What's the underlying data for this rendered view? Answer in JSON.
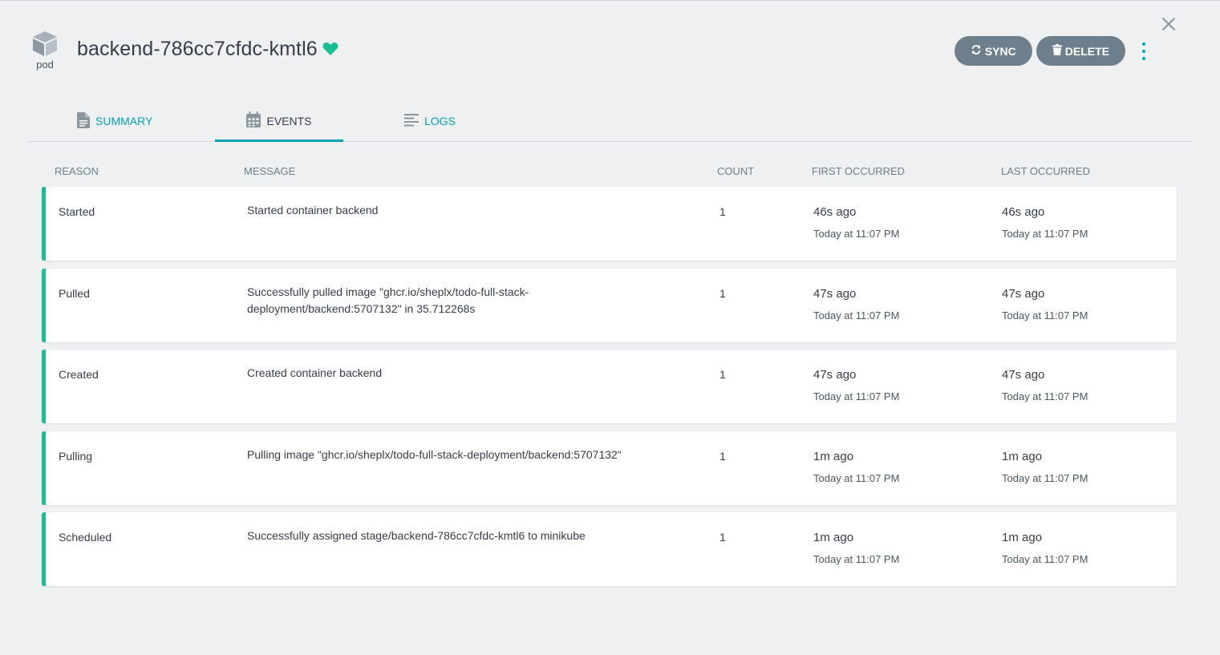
{
  "header": {
    "kind_label": "pod",
    "title": "backend-786cc7cfdc-kmtl6",
    "sync_label": "SYNC",
    "delete_label": "DELETE"
  },
  "tabs": [
    {
      "label": "SUMMARY"
    },
    {
      "label": "EVENTS"
    },
    {
      "label": "LOGS"
    }
  ],
  "columns": {
    "reason": "REASON",
    "message": "MESSAGE",
    "count": "COUNT",
    "first": "FIRST OCCURRED",
    "last": "LAST OCCURRED"
  },
  "events": [
    {
      "reason": "Started",
      "message": "Started container backend",
      "count": "1",
      "first_ago": "46s ago",
      "first_abs": "Today at 11:07 PM",
      "last_ago": "46s ago",
      "last_abs": "Today at 11:07 PM"
    },
    {
      "reason": "Pulled",
      "message": "Successfully pulled image \"ghcr.io/sheplx/todo-full-stack-deployment/backend:5707132\" in 35.712268s",
      "count": "1",
      "first_ago": "47s ago",
      "first_abs": "Today at 11:07 PM",
      "last_ago": "47s ago",
      "last_abs": "Today at 11:07 PM"
    },
    {
      "reason": "Created",
      "message": "Created container backend",
      "count": "1",
      "first_ago": "47s ago",
      "first_abs": "Today at 11:07 PM",
      "last_ago": "47s ago",
      "last_abs": "Today at 11:07 PM"
    },
    {
      "reason": "Pulling",
      "message": "Pulling image \"ghcr.io/sheplx/todo-full-stack-deployment/backend:5707132\"",
      "count": "1",
      "first_ago": "1m ago",
      "first_abs": "Today at 11:07 PM",
      "last_ago": "1m ago",
      "last_abs": "Today at 11:07 PM"
    },
    {
      "reason": "Scheduled",
      "message": "Successfully assigned stage/backend-786cc7cfdc-kmtl6 to minikube",
      "count": "1",
      "first_ago": "1m ago",
      "first_abs": "Today at 11:07 PM",
      "last_ago": "1m ago",
      "last_abs": "Today at 11:07 PM"
    }
  ],
  "colors": {
    "accent": "#00a2b3",
    "healthy": "#18be94",
    "button": "#6d7f8b"
  }
}
